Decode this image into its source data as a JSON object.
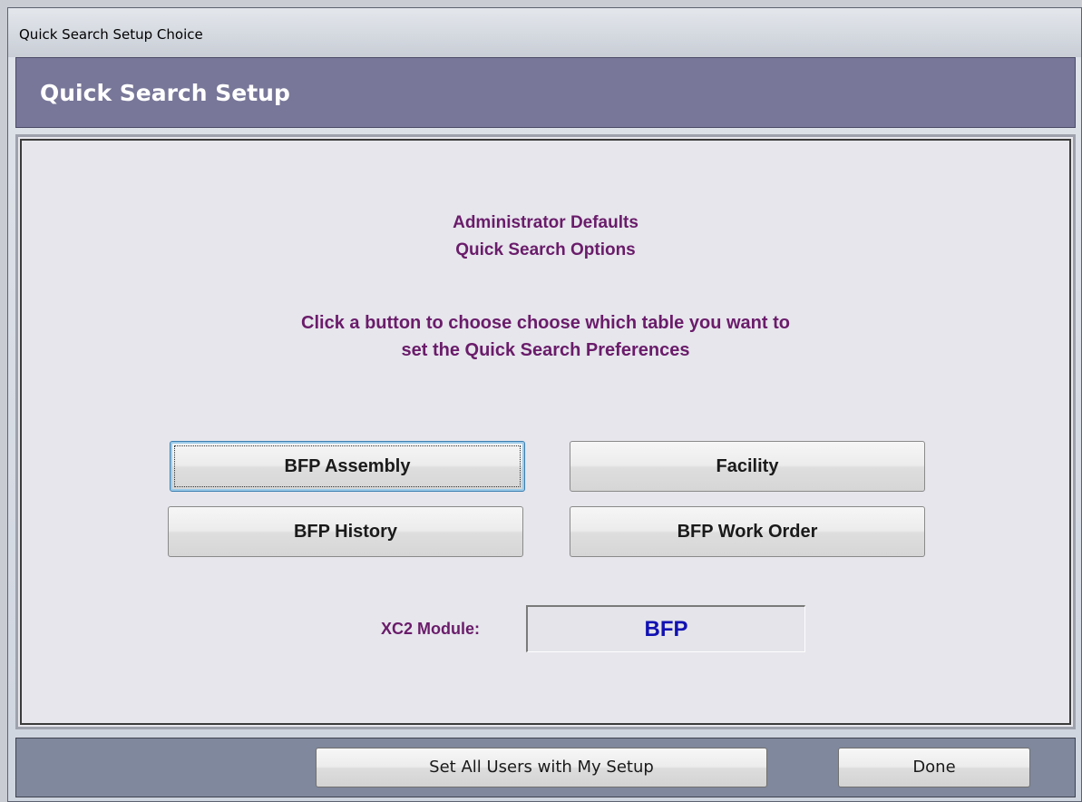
{
  "window": {
    "title": "Quick Search Setup Choice"
  },
  "header": {
    "title": "Quick Search Setup"
  },
  "main": {
    "heading_line1": "Administrator Defaults",
    "heading_line2": "Quick Search Options",
    "instruction_line1": "Click a button to choose choose which table you want to",
    "instruction_line2": "set the Quick Search Preferences",
    "buttons": {
      "bfp_assembly": "BFP Assembly",
      "facility": "Facility",
      "bfp_history": "BFP History",
      "bfp_work_order": "BFP Work Order"
    },
    "module_label": "XC2 Module:",
    "module_value": "BFP"
  },
  "footer": {
    "set_all_users": "Set All Users with My Setup",
    "done": "Done"
  },
  "colors": {
    "header_band": "#787799",
    "heading_text": "#6a1c6a",
    "module_value_text": "#1111b3",
    "footer_band": "#7f889c"
  }
}
